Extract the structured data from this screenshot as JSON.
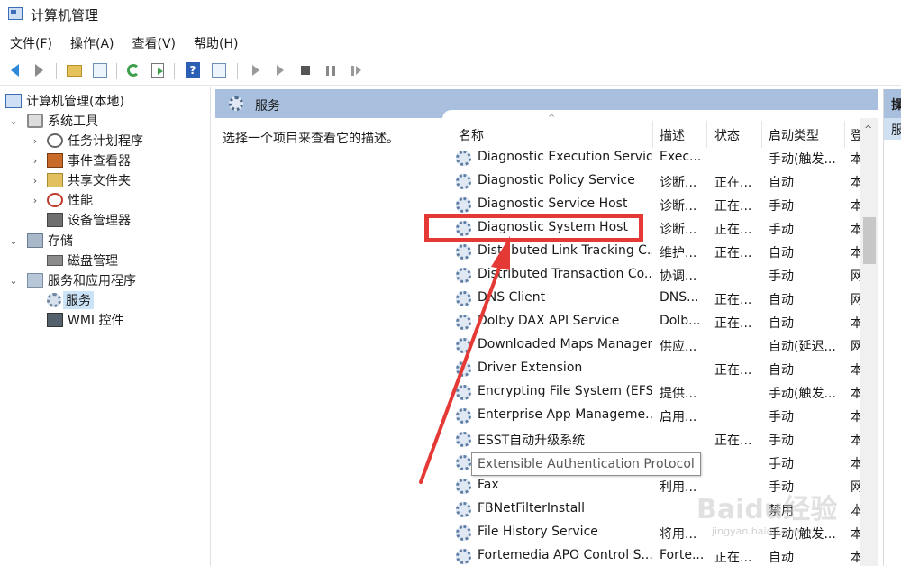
{
  "window": {
    "title": "计算机管理"
  },
  "menu": [
    "文件(F)",
    "操作(A)",
    "查看(V)",
    "帮助(H)"
  ],
  "toolbar": {
    "buttons": [
      "back-icon",
      "forward-icon",
      "up-folder-icon",
      "show-hide-tree-icon",
      "refresh-icon",
      "export-list-icon",
      "help-icon",
      "properties-icon",
      "start-service-icon",
      "start-service-alt-icon",
      "stop-service-icon",
      "pause-service-icon",
      "restart-service-icon"
    ]
  },
  "tree": {
    "root": "计算机管理(本地)",
    "system_tools": "系统工具",
    "task_scheduler": "任务计划程序",
    "event_viewer": "事件查看器",
    "shared_folders": "共享文件夹",
    "performance": "性能",
    "device_manager": "设备管理器",
    "storage": "存储",
    "disk_management": "磁盘管理",
    "services_apps": "服务和应用程序",
    "services": "服务",
    "wmi": "WMI 控件"
  },
  "panel": {
    "header": "服务",
    "description_hint": "选择一个项目来查看它的描述。"
  },
  "columns": {
    "name": "名称",
    "description": "描述",
    "status": "状态",
    "startup": "启动类型",
    "logon": "登"
  },
  "services": [
    {
      "name": "Diagnostic Execution Service",
      "desc": "Exec...",
      "status": "",
      "startup": "手动(触发...",
      "logon": "本"
    },
    {
      "name": "Diagnostic Policy Service",
      "desc": "诊断...",
      "status": "正在...",
      "startup": "自动",
      "logon": "本"
    },
    {
      "name": "Diagnostic Service Host",
      "desc": "诊断...",
      "status": "正在...",
      "startup": "手动",
      "logon": "本"
    },
    {
      "name": "Diagnostic System Host",
      "desc": "诊断...",
      "status": "正在...",
      "startup": "手动",
      "logon": "本"
    },
    {
      "name": "Distributed Link Tracking C...",
      "desc": "维护...",
      "status": "正在...",
      "startup": "自动",
      "logon": "本"
    },
    {
      "name": "Distributed Transaction Co...",
      "desc": "协调...",
      "status": "",
      "startup": "手动",
      "logon": "网"
    },
    {
      "name": "DNS Client",
      "desc": "DNS...",
      "status": "正在...",
      "startup": "自动",
      "logon": "网"
    },
    {
      "name": "Dolby DAX API Service",
      "desc": "Dolb...",
      "status": "正在...",
      "startup": "自动",
      "logon": "本"
    },
    {
      "name": "Downloaded Maps Manager",
      "desc": "供应...",
      "status": "",
      "startup": "自动(延迟...",
      "logon": "网"
    },
    {
      "name": "Driver Extension",
      "desc": "",
      "status": "正在...",
      "startup": "自动",
      "logon": "本"
    },
    {
      "name": "Encrypting File System (EFS)",
      "desc": "提供...",
      "status": "",
      "startup": "手动(触发...",
      "logon": "本"
    },
    {
      "name": "Enterprise App Manageme...",
      "desc": "启用...",
      "status": "",
      "startup": "手动",
      "logon": "本"
    },
    {
      "name": "ESST自动升级系统",
      "desc": "",
      "status": "正在...",
      "startup": "手动",
      "logon": "本"
    },
    {
      "name": "",
      "desc": "",
      "status": "",
      "startup": "手动",
      "logon": "本"
    },
    {
      "name": "Fax",
      "desc": "利用...",
      "status": "",
      "startup": "手动",
      "logon": "网"
    },
    {
      "name": "FBNetFilterInstall",
      "desc": "",
      "status": "",
      "startup": "禁用",
      "logon": "本"
    },
    {
      "name": "File History Service",
      "desc": "将用...",
      "status": "",
      "startup": "手动(触发...",
      "logon": "本"
    },
    {
      "name": "Fortemedia APO Control S...",
      "desc": "Forte...",
      "status": "正在...",
      "startup": "自动",
      "logon": "本"
    }
  ],
  "tooltip": "Extensible Authentication Protocol",
  "right_pane": {
    "header": "操",
    "item": "服"
  },
  "watermark": {
    "main": "Baidu经验",
    "sub": "jingyan.baidu.com"
  },
  "colors": {
    "panel_header": "#a8c0dd",
    "highlight": "#e53935",
    "selection": "#cce4f7"
  }
}
